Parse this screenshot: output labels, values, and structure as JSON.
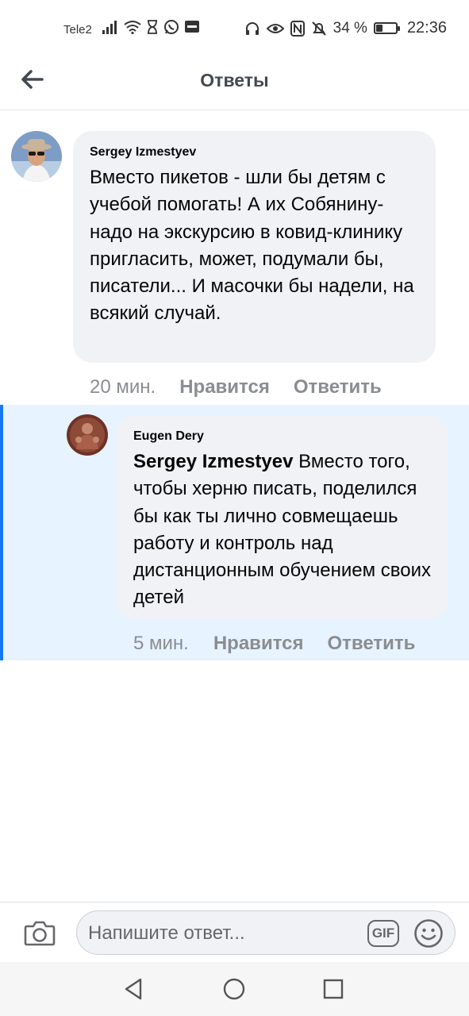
{
  "status_bar": {
    "carrier": "Tele2",
    "battery_text": "34 %",
    "battery_level": 0.34,
    "time": "22:36"
  },
  "header": {
    "title": "Ответы",
    "back_icon": "arrow-left-icon"
  },
  "comment": {
    "author": "Sergey Izmestyev",
    "text": "Вместо пикетов - шли бы детям с учебой помогать! А их Собянину-надо на экскурсию в ковид-клинику пригласить, может, подумали бы, писатели... И масочки бы надели, на всякий случай.",
    "time": "20 мин.",
    "like_label": "Нравится",
    "reply_label": "Ответить"
  },
  "reply": {
    "author": "Eugen Dery",
    "mention": "Sergey Izmestyev",
    "text": " Вместо того, чтобы херню писать, поделился бы как ты лично совмещаешь работу и контроль над дистанционным обучением своих детей",
    "time": "5 мин.",
    "like_label": "Нравится",
    "reply_label": "Ответить"
  },
  "composer": {
    "placeholder": "Напишите ответ...",
    "gif_label": "GIF",
    "camera_icon": "camera-icon",
    "emoji_icon": "emoji-icon"
  },
  "colors": {
    "accent": "#1877f2",
    "reply_highlight": "#e7f3ff",
    "bubble": "#f0f2f5"
  }
}
